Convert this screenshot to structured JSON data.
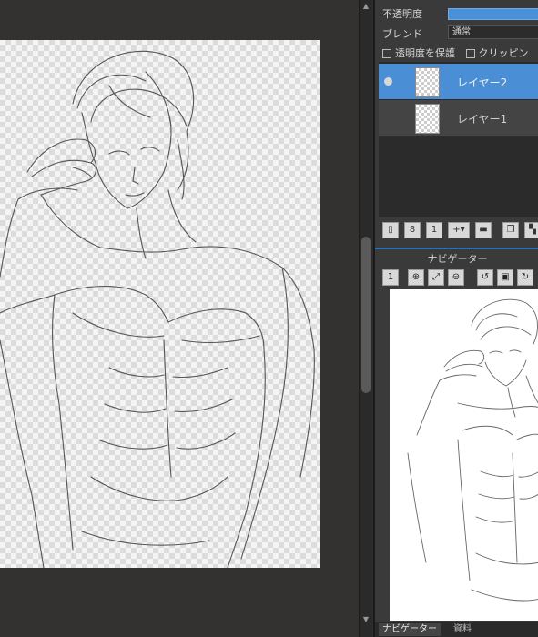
{
  "layers_panel": {
    "opacity_label": "不透明度",
    "blend_label": "ブレンド",
    "blend_value": "通常",
    "protect_alpha_label": "透明度を保護",
    "clipping_label": "クリッピン",
    "layers": [
      {
        "name": "レイヤー2",
        "active": true,
        "visible": true
      },
      {
        "name": "レイヤー1",
        "active": false,
        "visible": false
      }
    ]
  },
  "navigator": {
    "title": "ナビゲーター"
  },
  "bottom_tabs": [
    {
      "label": "ナビゲーター",
      "active": true
    },
    {
      "label": "資料",
      "active": false
    }
  ],
  "colors": {
    "accent": "#4a8fd6",
    "panel_bg": "#3a3a3a",
    "workspace_bg": "#333231"
  }
}
